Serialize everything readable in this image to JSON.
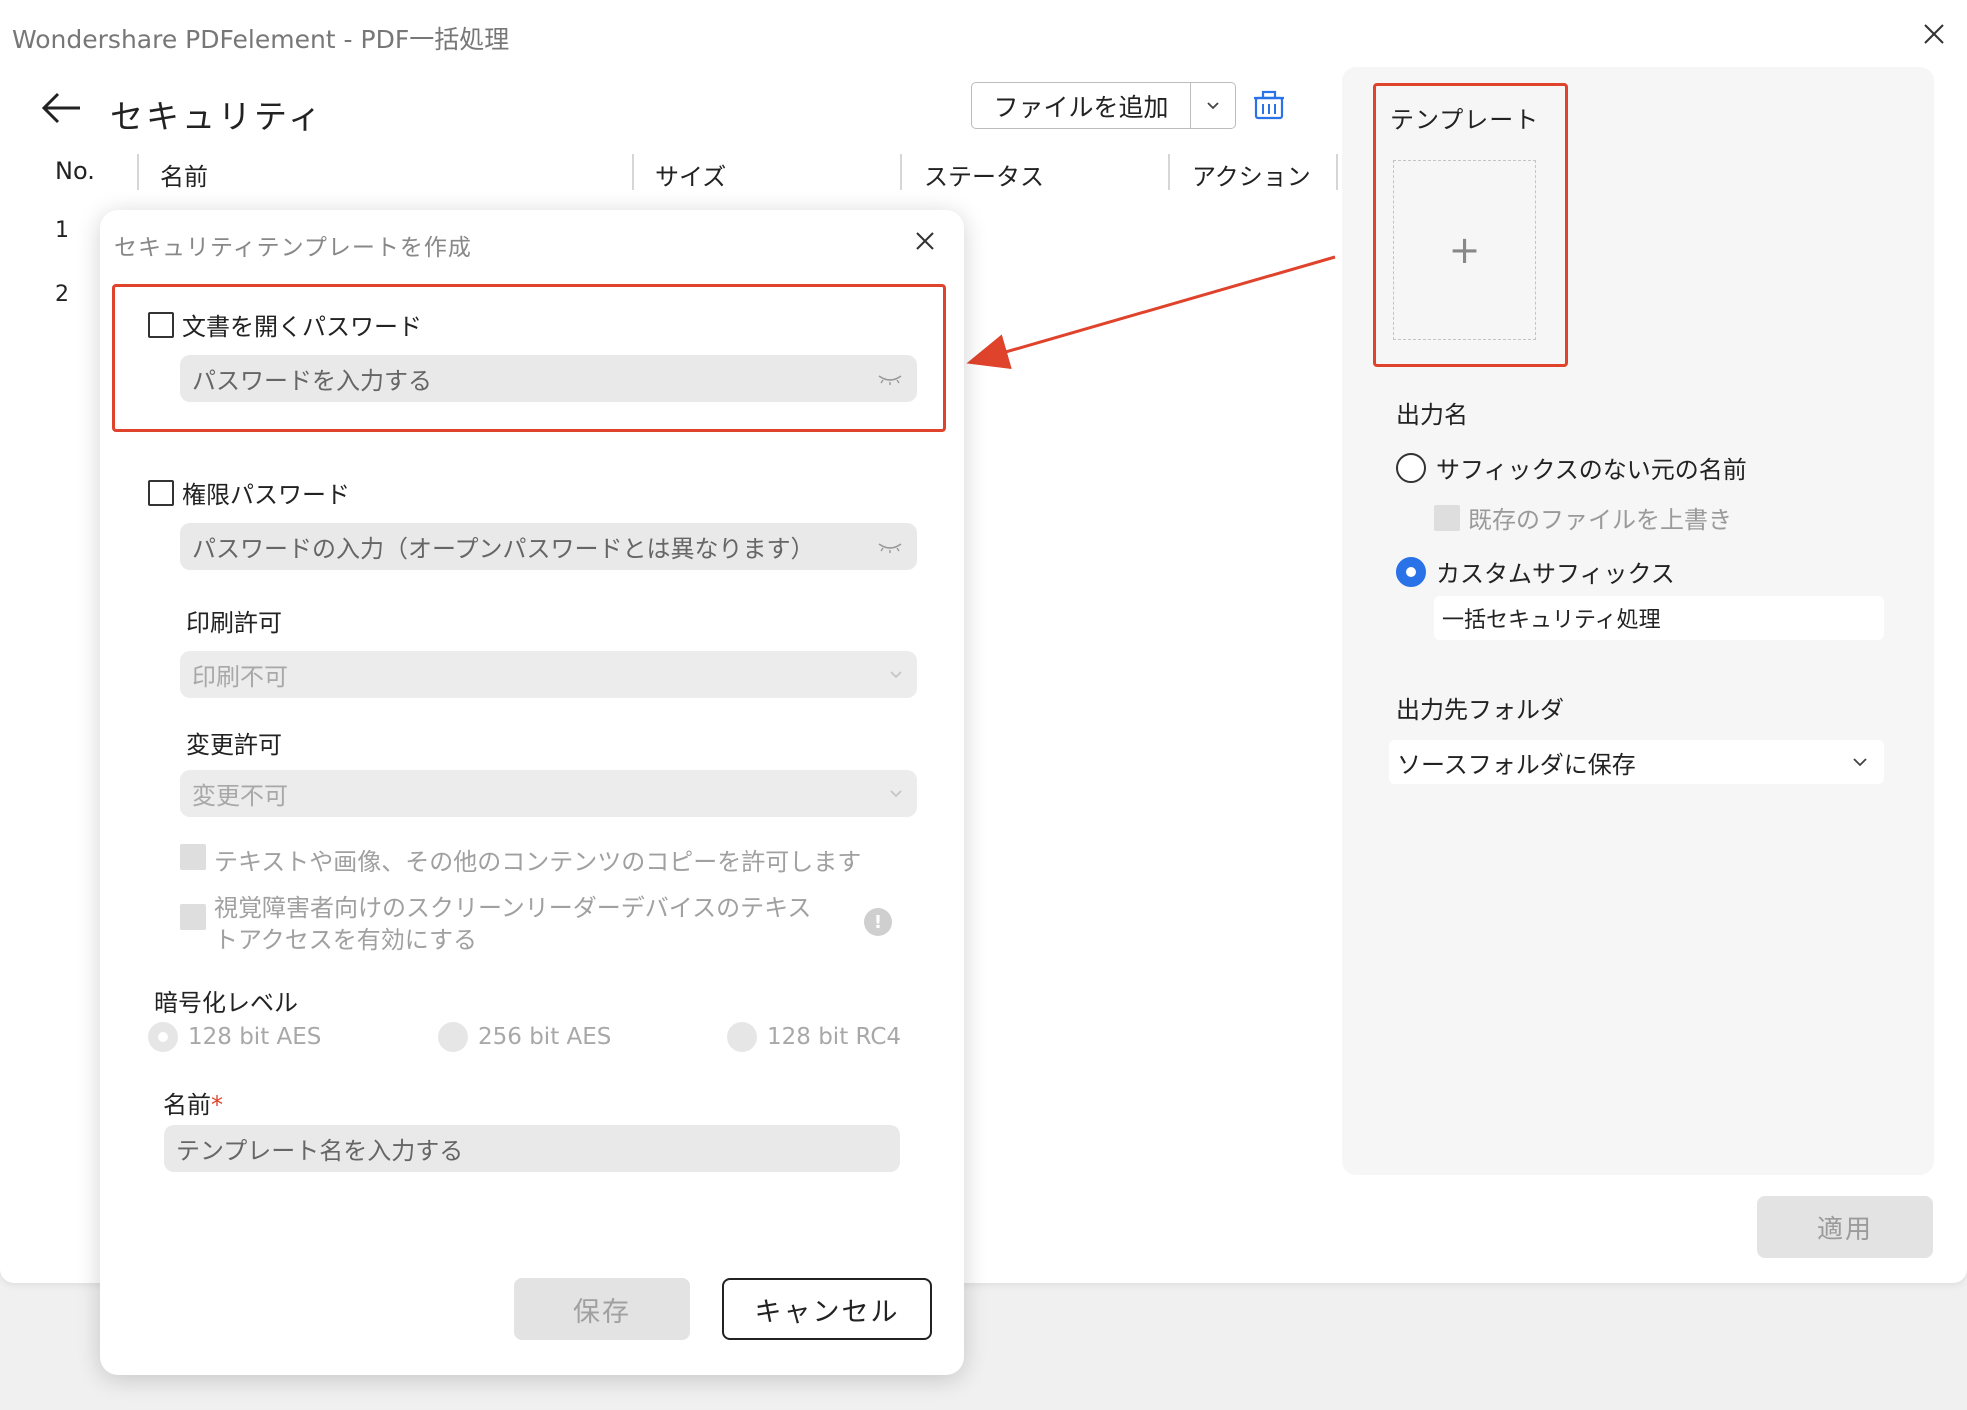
{
  "window": {
    "title": "Wondershare PDFelement - PDF一括処理"
  },
  "header": {
    "page_title": "セキュリティ",
    "add_file_label": "ファイルを追加"
  },
  "table": {
    "columns": [
      "No.",
      "名前",
      "サイズ",
      "ステータス",
      "アクション"
    ],
    "rows": [
      "1",
      "2"
    ]
  },
  "right_panel": {
    "template_label": "テンプレート",
    "template_add_symbol": "+",
    "output_name_label": "出力名",
    "option_no_suffix": "サフィックスのない元の名前",
    "overwrite_label": "既存のファイルを上書き",
    "option_custom_suffix": "カスタムサフィックス",
    "custom_suffix_value": "一括セキュリティ処理",
    "output_folder_label": "出力先フォルダ",
    "output_folder_value": "ソースフォルダに保存",
    "apply_label": "適用",
    "selected_output_option": "custom_suffix"
  },
  "dialog": {
    "title": "セキュリティテンプレートを作成",
    "open_password_label": "文書を開くパスワード",
    "open_password_placeholder": "パスワードを入力する",
    "permission_password_label": "権限パスワード",
    "permission_password_placeholder": "パスワードの入力（オープンパスワードとは異なります）",
    "print_permission_label": "印刷許可",
    "print_permission_value": "印刷不可",
    "change_permission_label": "変更許可",
    "change_permission_value": "変更不可",
    "copy_content_label": "テキストや画像、その他のコンテンツのコピーを許可します",
    "screen_reader_label_line1": "視覚障害者向けのスクリーンリーダーデバイスのテキス",
    "screen_reader_label_line2": "トアクセスを有効にする",
    "encryption_level_label": "暗号化レベル",
    "encryption_options": [
      "128 bit AES",
      "256 bit AES",
      "128 bit RC4"
    ],
    "selected_encryption": "128 bit AES",
    "name_label": "名前",
    "required_mark": "*",
    "name_placeholder": "テンプレート名を入力する",
    "save_label": "保存",
    "cancel_label": "キャンセル",
    "info_symbol": "!"
  },
  "colors": {
    "highlight": "#e0432c",
    "accent_blue": "#2a72e8"
  }
}
